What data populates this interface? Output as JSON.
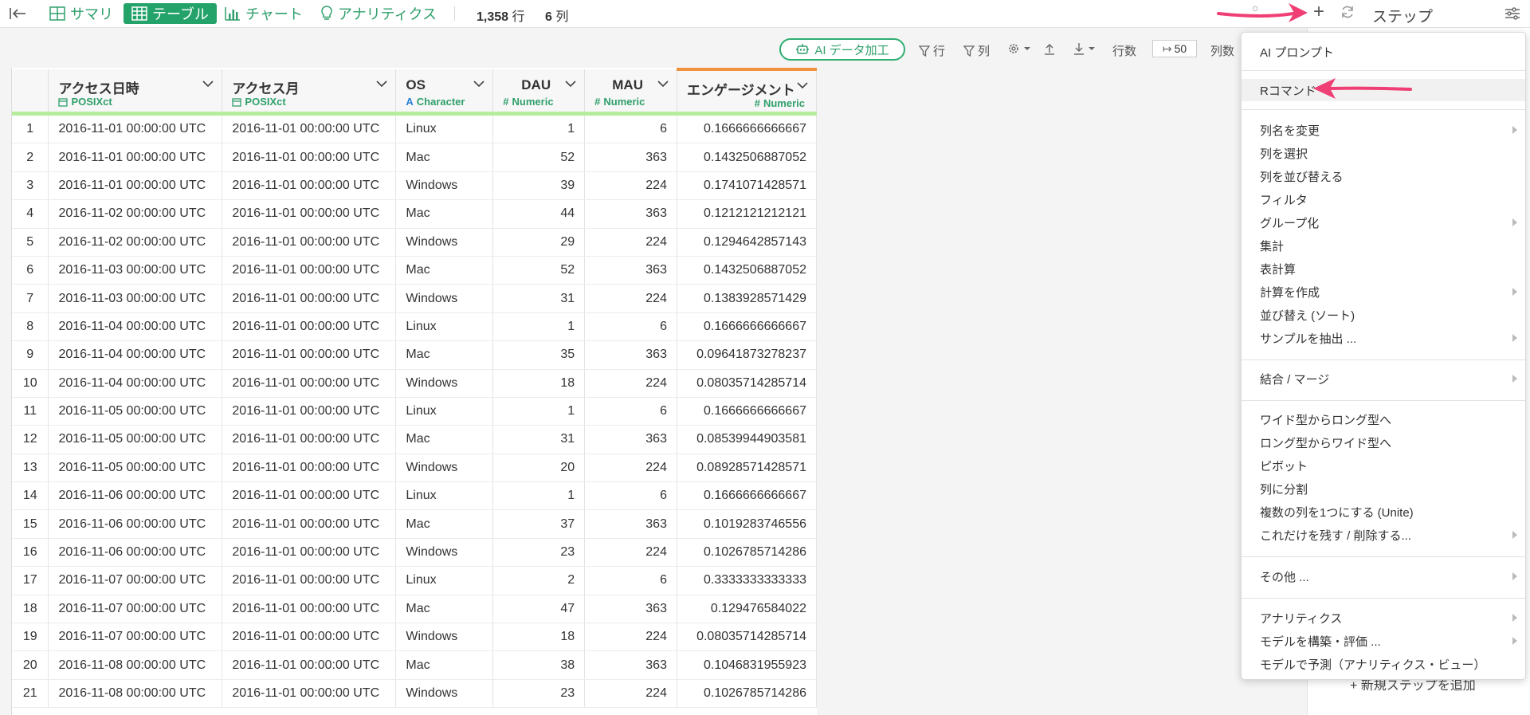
{
  "topbar": {
    "tabs": [
      {
        "label": "サマリ",
        "icon": "summary-grid-icon"
      },
      {
        "label": "テーブル",
        "icon": "table-icon"
      },
      {
        "label": "チャート",
        "icon": "bar-chart-icon"
      },
      {
        "label": "アナリティクス",
        "icon": "lightbulb-icon"
      }
    ],
    "rows_count": "1,358",
    "rows_unit": "行",
    "cols_count": "6",
    "cols_unit": "列",
    "steps_label": "ステップ"
  },
  "toolbar": {
    "ai_button": "AI データ加工",
    "row_filter": "行",
    "col_filter": "列",
    "rows_label": "行数",
    "rows_value": "50",
    "cols_label": "列数"
  },
  "table": {
    "columns": [
      {
        "name": "アクセス日時",
        "type": "POSIXct",
        "type_icon": "calendar-icon"
      },
      {
        "name": "アクセス月",
        "type": "POSIXct",
        "type_icon": "calendar-icon"
      },
      {
        "name": "OS",
        "type": "Character",
        "type_icon": "A"
      },
      {
        "name": "DAU",
        "type": "Numeric",
        "type_icon": "#"
      },
      {
        "name": "MAU",
        "type": "Numeric",
        "type_icon": "#"
      },
      {
        "name": "エンゲージメント",
        "type": "Numeric",
        "type_icon": "#"
      }
    ],
    "rows": [
      [
        "1",
        "2016-11-01 00:00:00 UTC",
        "2016-11-01 00:00:00 UTC",
        "Linux",
        "1",
        "6",
        "0.1666666666667"
      ],
      [
        "2",
        "2016-11-01 00:00:00 UTC",
        "2016-11-01 00:00:00 UTC",
        "Mac",
        "52",
        "363",
        "0.1432506887052"
      ],
      [
        "3",
        "2016-11-01 00:00:00 UTC",
        "2016-11-01 00:00:00 UTC",
        "Windows",
        "39",
        "224",
        "0.1741071428571"
      ],
      [
        "4",
        "2016-11-02 00:00:00 UTC",
        "2016-11-01 00:00:00 UTC",
        "Mac",
        "44",
        "363",
        "0.1212121212121"
      ],
      [
        "5",
        "2016-11-02 00:00:00 UTC",
        "2016-11-01 00:00:00 UTC",
        "Windows",
        "29",
        "224",
        "0.1294642857143"
      ],
      [
        "6",
        "2016-11-03 00:00:00 UTC",
        "2016-11-01 00:00:00 UTC",
        "Mac",
        "52",
        "363",
        "0.1432506887052"
      ],
      [
        "7",
        "2016-11-03 00:00:00 UTC",
        "2016-11-01 00:00:00 UTC",
        "Windows",
        "31",
        "224",
        "0.1383928571429"
      ],
      [
        "8",
        "2016-11-04 00:00:00 UTC",
        "2016-11-01 00:00:00 UTC",
        "Linux",
        "1",
        "6",
        "0.1666666666667"
      ],
      [
        "9",
        "2016-11-04 00:00:00 UTC",
        "2016-11-01 00:00:00 UTC",
        "Mac",
        "35",
        "363",
        "0.09641873278237"
      ],
      [
        "10",
        "2016-11-04 00:00:00 UTC",
        "2016-11-01 00:00:00 UTC",
        "Windows",
        "18",
        "224",
        "0.08035714285714"
      ],
      [
        "11",
        "2016-11-05 00:00:00 UTC",
        "2016-11-01 00:00:00 UTC",
        "Linux",
        "1",
        "6",
        "0.1666666666667"
      ],
      [
        "12",
        "2016-11-05 00:00:00 UTC",
        "2016-11-01 00:00:00 UTC",
        "Mac",
        "31",
        "363",
        "0.08539944903581"
      ],
      [
        "13",
        "2016-11-05 00:00:00 UTC",
        "2016-11-01 00:00:00 UTC",
        "Windows",
        "20",
        "224",
        "0.08928571428571"
      ],
      [
        "14",
        "2016-11-06 00:00:00 UTC",
        "2016-11-01 00:00:00 UTC",
        "Linux",
        "1",
        "6",
        "0.1666666666667"
      ],
      [
        "15",
        "2016-11-06 00:00:00 UTC",
        "2016-11-01 00:00:00 UTC",
        "Mac",
        "37",
        "363",
        "0.1019283746556"
      ],
      [
        "16",
        "2016-11-06 00:00:00 UTC",
        "2016-11-01 00:00:00 UTC",
        "Windows",
        "23",
        "224",
        "0.1026785714286"
      ],
      [
        "17",
        "2016-11-07 00:00:00 UTC",
        "2016-11-01 00:00:00 UTC",
        "Linux",
        "2",
        "6",
        "0.3333333333333"
      ],
      [
        "18",
        "2016-11-07 00:00:00 UTC",
        "2016-11-01 00:00:00 UTC",
        "Mac",
        "47",
        "363",
        "0.129476584022"
      ],
      [
        "19",
        "2016-11-07 00:00:00 UTC",
        "2016-11-01 00:00:00 UTC",
        "Windows",
        "18",
        "224",
        "0.08035714285714"
      ],
      [
        "20",
        "2016-11-08 00:00:00 UTC",
        "2016-11-01 00:00:00 UTC",
        "Mac",
        "38",
        "363",
        "0.1046831955923"
      ],
      [
        "21",
        "2016-11-08 00:00:00 UTC",
        "2016-11-01 00:00:00 UTC",
        "Windows",
        "23",
        "224",
        "0.1026785714286"
      ]
    ]
  },
  "menu": {
    "items": [
      {
        "label": "AI プロンプト",
        "submenu": false
      },
      {
        "label": "Rコマンド",
        "submenu": false,
        "highlighted": true
      },
      {
        "label": "列名を変更",
        "submenu": true
      },
      {
        "label": "列を選択",
        "submenu": false
      },
      {
        "label": "列を並び替える",
        "submenu": false
      },
      {
        "label": "フィルタ",
        "submenu": false
      },
      {
        "label": "グループ化",
        "submenu": true
      },
      {
        "label": "集計",
        "submenu": false
      },
      {
        "label": "表計算",
        "submenu": false
      },
      {
        "label": "計算を作成",
        "submenu": true
      },
      {
        "label": "並び替え (ソート)",
        "submenu": false
      },
      {
        "label": "サンプルを抽出 ...",
        "submenu": true
      },
      {
        "label": "結合 / マージ",
        "submenu": true
      },
      {
        "label": "ワイド型からロング型へ",
        "submenu": false
      },
      {
        "label": "ロング型からワイド型へ",
        "submenu": false
      },
      {
        "label": "ピボット",
        "submenu": false
      },
      {
        "label": "列に分割",
        "submenu": false
      },
      {
        "label": "複数の列を1つにする (Unite)",
        "submenu": false
      },
      {
        "label": "これだけを残す / 削除する...",
        "submenu": true
      },
      {
        "label": "その他 ...",
        "submenu": true
      },
      {
        "label": "アナリティクス",
        "submenu": true
      },
      {
        "label": "モデルを構築・評価 ...",
        "submenu": true
      },
      {
        "label": "モデルで予測（アナリティクス・ビュー）",
        "submenu": false
      }
    ]
  },
  "step_panel": {
    "add_step": "新規ステップを追加"
  },
  "colors": {
    "accent_green": "#23a36a",
    "annotation_arrow": "#ef3f74",
    "engagement_header_border": "#f0913e"
  }
}
